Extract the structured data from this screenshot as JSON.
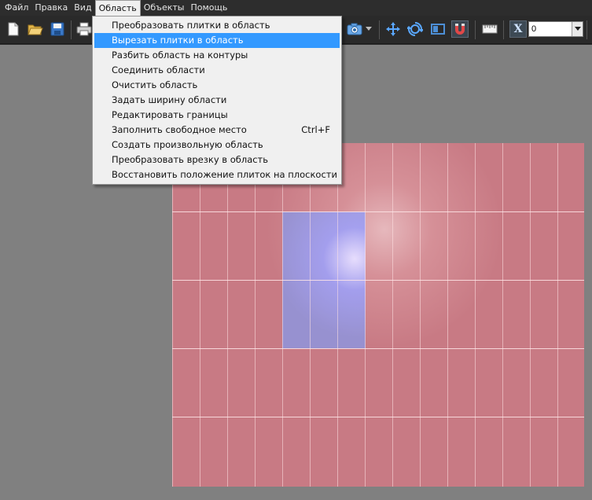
{
  "menubar": {
    "items": [
      {
        "label": "Файл"
      },
      {
        "label": "Правка"
      },
      {
        "label": "Вид"
      },
      {
        "label": "Область"
      },
      {
        "label": "Объекты"
      },
      {
        "label": "Помощь"
      }
    ]
  },
  "dropdown": {
    "items": [
      {
        "label": "Преобразовать плитки в область",
        "shortcut": ""
      },
      {
        "label": "Вырезать плитки в область",
        "shortcut": ""
      },
      {
        "label": "Разбить область на контуры",
        "shortcut": ""
      },
      {
        "label": "Соединить области",
        "shortcut": ""
      },
      {
        "label": "Очистить область",
        "shortcut": ""
      },
      {
        "label": "Задать ширину области",
        "shortcut": ""
      },
      {
        "label": "Редактировать границы",
        "shortcut": ""
      },
      {
        "label": "Заполнить свободное место",
        "shortcut": "Ctrl+F"
      },
      {
        "label": "Создать произвольную область",
        "shortcut": ""
      },
      {
        "label": "Преобразовать врезку в область",
        "shortcut": ""
      },
      {
        "label": "Восстановить положение плиток на плоскости",
        "shortcut": ""
      }
    ],
    "highlighted_index": 1
  },
  "toolbar": {
    "axis_label": "X",
    "coord_value": "0"
  },
  "colors": {
    "selection": "#3399ff",
    "tile_surface": "#c87a84",
    "selected_tiles": "#8c96e1",
    "viewport_bg": "#808080"
  }
}
